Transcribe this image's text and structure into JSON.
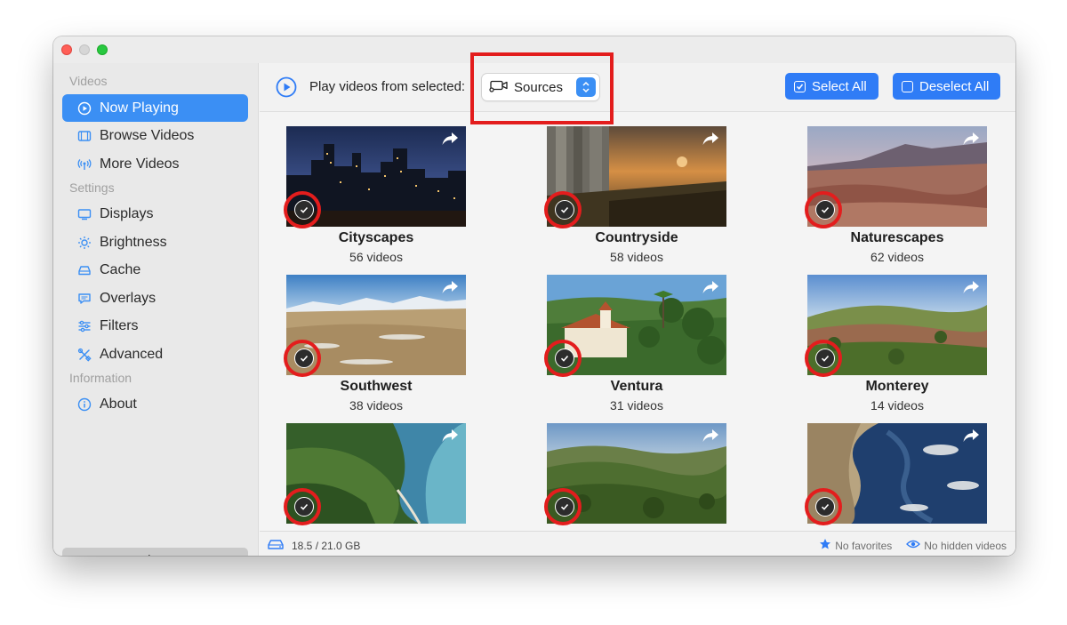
{
  "sidebar": {
    "sections": [
      {
        "label": "Videos",
        "items": [
          {
            "label": "Now Playing",
            "icon": "play-circle-icon",
            "active": true
          },
          {
            "label": "Browse Videos",
            "icon": "film-icon"
          },
          {
            "label": "More Videos",
            "icon": "antenna-icon"
          }
        ]
      },
      {
        "label": "Settings",
        "items": [
          {
            "label": "Displays",
            "icon": "display-icon"
          },
          {
            "label": "Brightness",
            "icon": "sun-icon"
          },
          {
            "label": "Cache",
            "icon": "drive-icon"
          },
          {
            "label": "Overlays",
            "icon": "speech-bubble-icon"
          },
          {
            "label": "Filters",
            "icon": "sliders-icon"
          },
          {
            "label": "Advanced",
            "icon": "tools-icon"
          }
        ]
      },
      {
        "label": "Information",
        "items": [
          {
            "label": "About",
            "icon": "info-icon"
          }
        ]
      }
    ],
    "close_label": "Close"
  },
  "toolbar": {
    "play_label": "Play videos from selected:",
    "source_select_value": "Sources",
    "select_all_label": "Select All",
    "deselect_all_label": "Deselect All"
  },
  "tiles": [
    {
      "title": "Cityscapes",
      "count": "56 videos",
      "selected": true
    },
    {
      "title": "Countryside",
      "count": "58 videos",
      "selected": true
    },
    {
      "title": "Naturescapes",
      "count": "62 videos",
      "selected": true
    },
    {
      "title": "Southwest",
      "count": "38 videos",
      "selected": true
    },
    {
      "title": "Ventura",
      "count": "31 videos",
      "selected": true
    },
    {
      "title": "Monterey",
      "count": "14 videos",
      "selected": true
    },
    {
      "title": "",
      "count": "",
      "selected": true
    },
    {
      "title": "",
      "count": "",
      "selected": true
    },
    {
      "title": "",
      "count": "",
      "selected": true
    }
  ],
  "status": {
    "storage": "18.5 / 21.0 GB",
    "favorites": "No favorites",
    "hidden": "No hidden videos"
  },
  "colors": {
    "accent": "#3b8ff4",
    "button": "#2f7cf6",
    "highlight": "#e31d1d"
  }
}
